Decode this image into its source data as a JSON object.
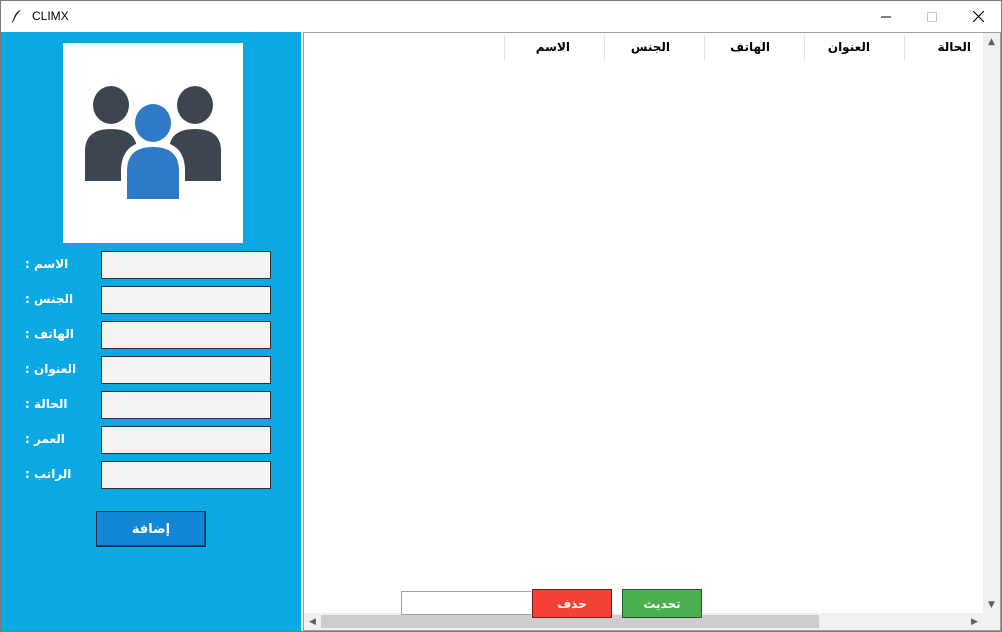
{
  "window": {
    "title": "CLIMX",
    "icon": "feather-icon"
  },
  "colors": {
    "sidebar": "#0aa9e3",
    "add_button": "#1386d6",
    "delete_button": "#f44336",
    "refresh_button": "#4caf50",
    "avatar_dark": "#3d4650",
    "avatar_accent": "#2f7ac6"
  },
  "form": {
    "avatar_icon": "user-group-icon",
    "fields": [
      {
        "label": ": الاسم",
        "value": ""
      },
      {
        "label": ": الجنس",
        "value": ""
      },
      {
        "label": ": الهاتف",
        "value": ""
      },
      {
        "label": ": العنوان",
        "value": ""
      },
      {
        "label": ": الحالة",
        "value": ""
      },
      {
        "label": ": العمر",
        "value": ""
      },
      {
        "label": ": الراتب",
        "value": ""
      }
    ],
    "add_label": "إضافة"
  },
  "table": {
    "columns": [
      "الحالة",
      "العنوان",
      "الهاتف",
      "الجنس",
      "الاسم"
    ],
    "rows": []
  },
  "footer": {
    "search_value": "",
    "delete_label": "حذف",
    "refresh_label": "تحديث"
  }
}
